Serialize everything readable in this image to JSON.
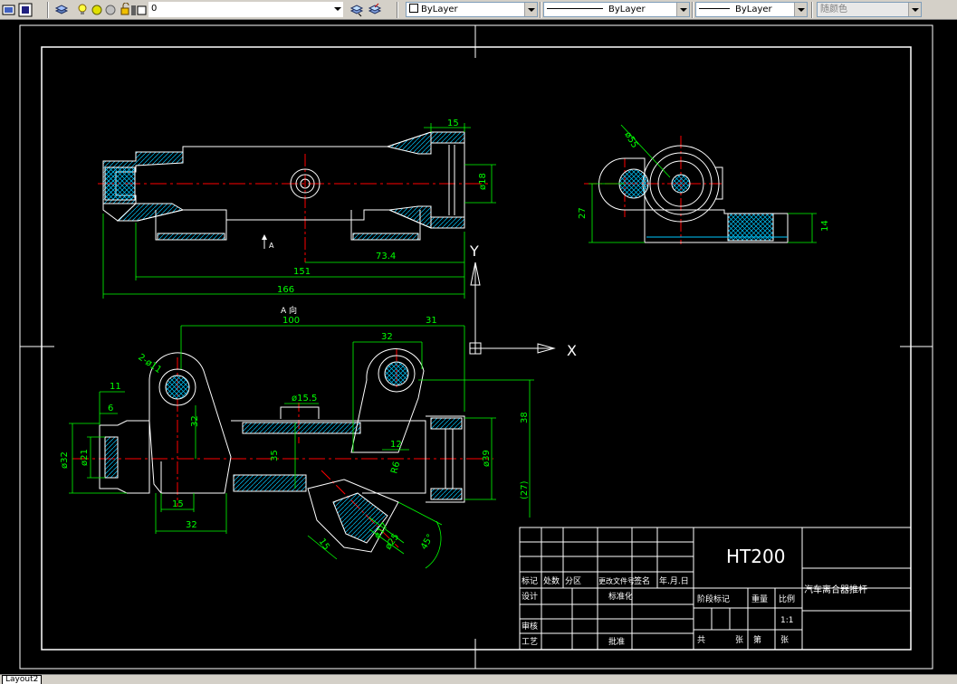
{
  "toolbar": {
    "layer_value": "0",
    "color_value": "ByLayer",
    "linetype_value": "ByLayer",
    "lineweight_value": "ByLayer",
    "plotstyle_value": "随颜色"
  },
  "drawing": {
    "dims_top": [
      "15",
      "ø18",
      "73.4",
      "151",
      "166",
      "A"
    ],
    "dims_side": [
      "ø55",
      "27",
      "14"
    ],
    "dims_bottom": [
      "A 向",
      "100",
      "31",
      "2-ø11",
      "32",
      "11",
      "6",
      "ø32",
      "ø21",
      "32",
      "ø15.5",
      "35",
      "12",
      "R6",
      "38",
      "ø39",
      "(27)",
      "15",
      "32",
      "15",
      "ø17",
      "ø25",
      "45°"
    ],
    "ucs": {
      "y_label": "Y",
      "x_label": "X"
    }
  },
  "title_block": {
    "material": "HT200",
    "part_name": "汽车离合器推杆",
    "row_labels": [
      "标记",
      "处数",
      "分区",
      "更改文件号",
      "签名",
      "年.月.日"
    ],
    "design_label": "设计",
    "std_label": "标准化",
    "stage_label": "阶段标记",
    "weight_label": "重量",
    "scale_label": "比例",
    "scale_value": "1:1",
    "review_label": "审核",
    "process_label": "工艺",
    "approve_label": "批准",
    "sheets": [
      "共",
      "张",
      "第",
      "张"
    ]
  },
  "status": {
    "layout_tab": "Layout2"
  },
  "colors": {
    "background": "#000000",
    "geometry": "#ffffff",
    "dimension": "#00ff00",
    "center": "#ff0000",
    "hatch": "#00ffff"
  }
}
